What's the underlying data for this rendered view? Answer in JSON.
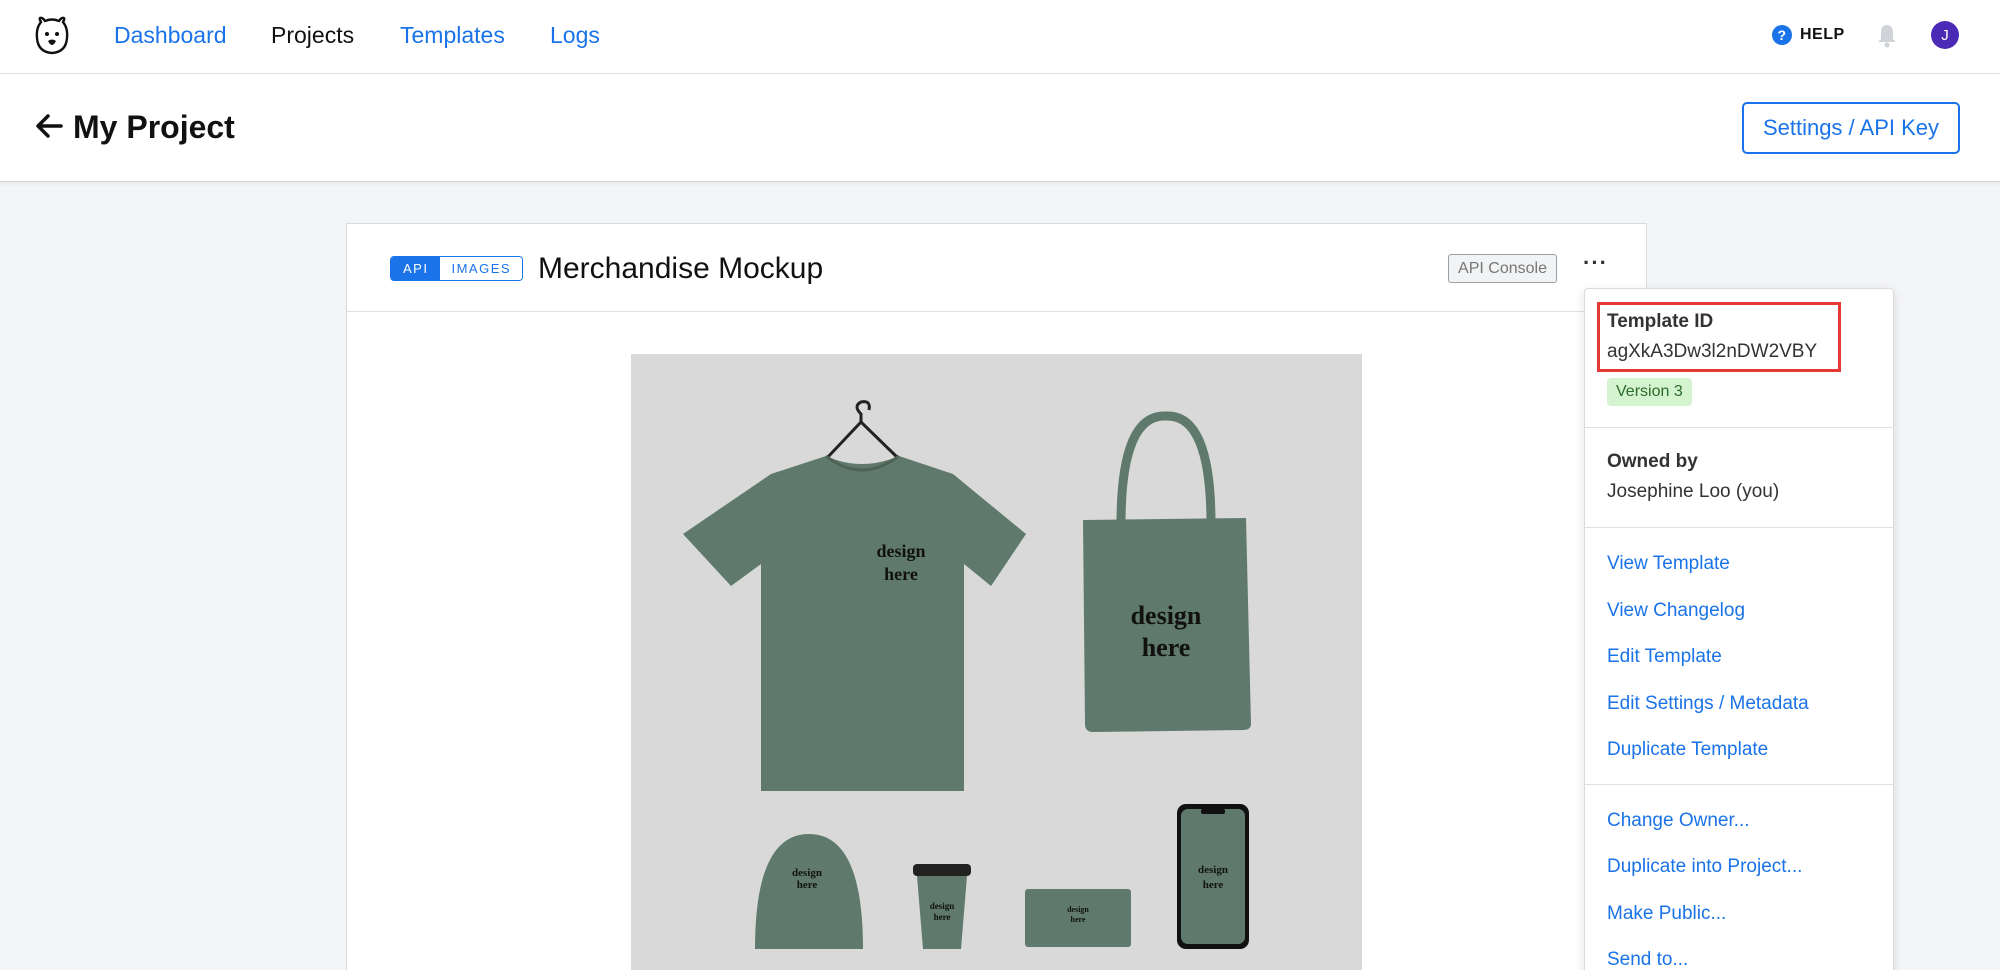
{
  "nav": {
    "links": [
      "Dashboard",
      "Projects",
      "Templates",
      "Logs"
    ],
    "help_label": "HELP",
    "avatar_initial": "J"
  },
  "project": {
    "title": "My Project",
    "settings_label": "Settings / API Key"
  },
  "template_card": {
    "badge_api": "API",
    "badge_images": "IMAGES",
    "title": "Merchandise Mockup",
    "console_label": "API Console",
    "more_label": "···",
    "preview_texts": [
      "design",
      "here"
    ]
  },
  "dropdown": {
    "template_id_label": "Template ID",
    "template_id_value": "agXkA3Dw3l2nDW2VBY",
    "version": "Version 3",
    "owned_by_label": "Owned by",
    "owned_by_value": "Josephine Loo (you)",
    "actions_1": [
      "View Template",
      "View Changelog",
      "Edit Template",
      "Edit Settings / Metadata",
      "Duplicate Template"
    ],
    "actions_2": [
      "Change Owner...",
      "Duplicate into Project...",
      "Make Public...",
      "Send to..."
    ]
  },
  "colors": {
    "accent": "#1a73e8",
    "highlight": "#e53935",
    "product_green": "#5f7a6c",
    "version_bg": "#d4f4cf"
  }
}
